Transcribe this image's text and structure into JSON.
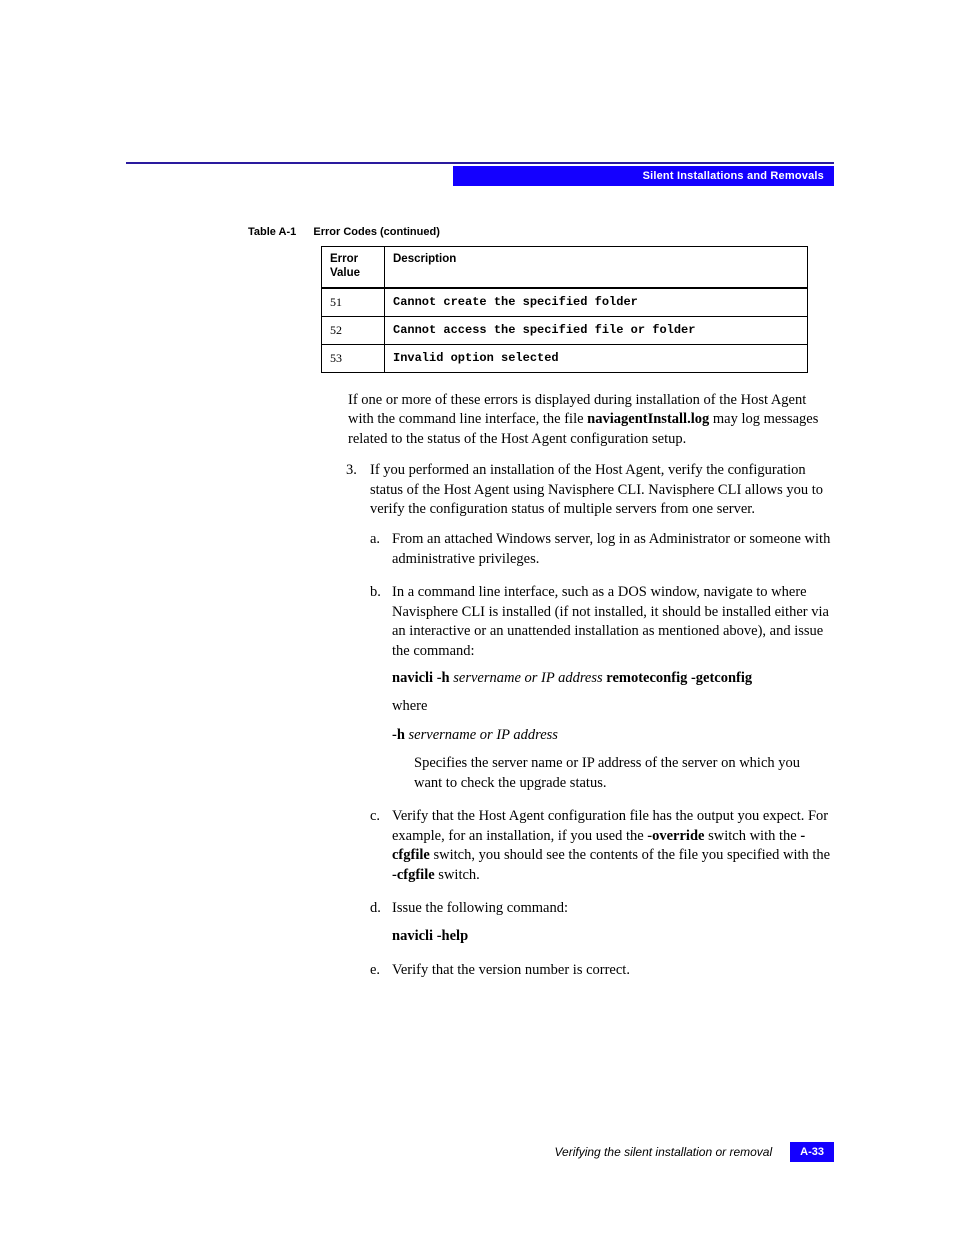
{
  "header": {
    "section_title": "Silent Installations and Removals"
  },
  "table": {
    "label": "Table A-1",
    "title": "Error Codes (continued)",
    "columns": {
      "c1": "Error Value",
      "c2": "Description"
    },
    "rows": [
      {
        "value": "51",
        "desc": "Cannot create the specified folder"
      },
      {
        "value": "52",
        "desc": "Cannot access the specified file or folder"
      },
      {
        "value": "53",
        "desc": "Invalid option selected"
      }
    ]
  },
  "para1": {
    "pre": "If one or more of these errors is displayed during installation of the Host Agent with the command line interface, the file ",
    "bold": "naviagentInstall.log",
    "post": " may log messages related to the status of the Host Agent configuration setup."
  },
  "step3": {
    "text": "If you performed an installation of the Host Agent, verify the configuration status of the Host Agent using Navisphere CLI. Navisphere CLI allows you to verify the configuration status of multiple servers from one server.",
    "a": "From an attached Windows server, log in as Administrator or someone with administrative privileges.",
    "b": {
      "intro": "In a command line interface, such as a DOS window, navigate to where Navisphere CLI is installed (if not installed, it should be installed either via an interactive or an unattended installation as mentioned above), and issue the command:",
      "cmd": {
        "b1": "navicli -h",
        "i1": "servername or IP address",
        "b2": "remoteconfig -getconfig"
      },
      "where_label": "where",
      "arg": {
        "b": "-h",
        "i": "servername or IP address"
      },
      "arg_desc": "Specifies the server name or IP address of the server on which you want to check the upgrade status."
    },
    "c": {
      "pre": "Verify that the Host Agent configuration file has the output you expect. For example, for an installation, if you used the ",
      "b1": "-override",
      "mid1": " switch with the ",
      "b2": "-cfgfile",
      "mid2": " switch, you should see the contents of the file you specified with the ",
      "b3": "-cfgfile",
      "post": " switch."
    },
    "d": {
      "text": "Issue the following command:",
      "cmd": "navicli -help"
    },
    "e": "Verify that the version number is correct."
  },
  "footer": {
    "title": "Verifying the silent installation or removal",
    "page": "A-33"
  },
  "markers": {
    "a": "a.",
    "b": "b.",
    "c": "c.",
    "d": "d.",
    "e": "e."
  }
}
